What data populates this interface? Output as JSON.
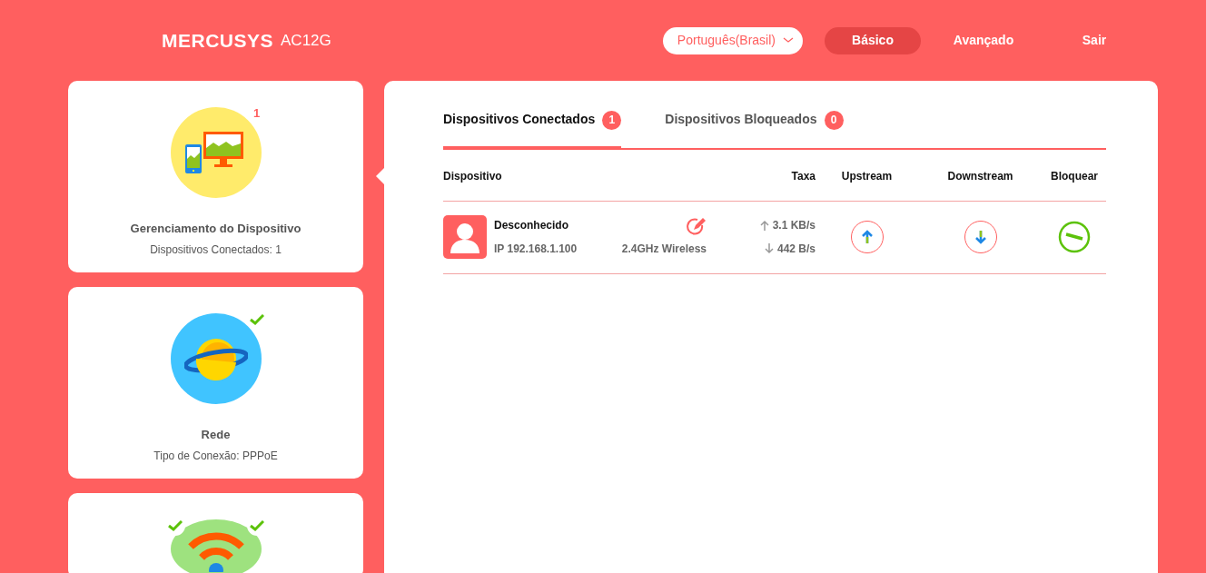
{
  "header": {
    "brand": "MERCUSYS",
    "model": "AC12G",
    "language": "Português(Brasil)",
    "nav": [
      {
        "label": "Básico",
        "selected": true
      },
      {
        "label": "Avançado",
        "selected": false
      },
      {
        "label": "Sair",
        "selected": false
      }
    ]
  },
  "sidebar": {
    "cards": [
      {
        "kind": "devices",
        "selected": true,
        "title": "Gerenciamento do Dispositivo",
        "subtitle": "Dispositivos Conectados: 1",
        "badges": [
          {
            "kind": "count",
            "text": "1"
          }
        ]
      },
      {
        "kind": "network",
        "selected": false,
        "title": "Rede",
        "subtitle": "Tipo de Conexão: PPPoE",
        "badges": [
          {
            "kind": "check"
          }
        ]
      },
      {
        "kind": "wireless",
        "selected": false,
        "badges": [
          {
            "kind": "check"
          },
          {
            "kind": "check"
          }
        ]
      }
    ]
  },
  "tabs": [
    {
      "label": "Dispositivos Conectados",
      "count": "1",
      "selected": true
    },
    {
      "label": "Dispositivos Bloqueados",
      "count": "0",
      "selected": false
    }
  ],
  "table": {
    "columns": [
      "Dispositivo",
      "Taxa",
      "Upstream",
      "Downstream",
      "Bloquear"
    ],
    "rows": [
      {
        "name": "Desconhecido",
        "ip": "IP 192.168.1.100",
        "connection": "2.4GHz Wireless",
        "up_rate": "3.1 KB/s",
        "down_rate": "442 B/s",
        "blocked": false
      }
    ]
  }
}
